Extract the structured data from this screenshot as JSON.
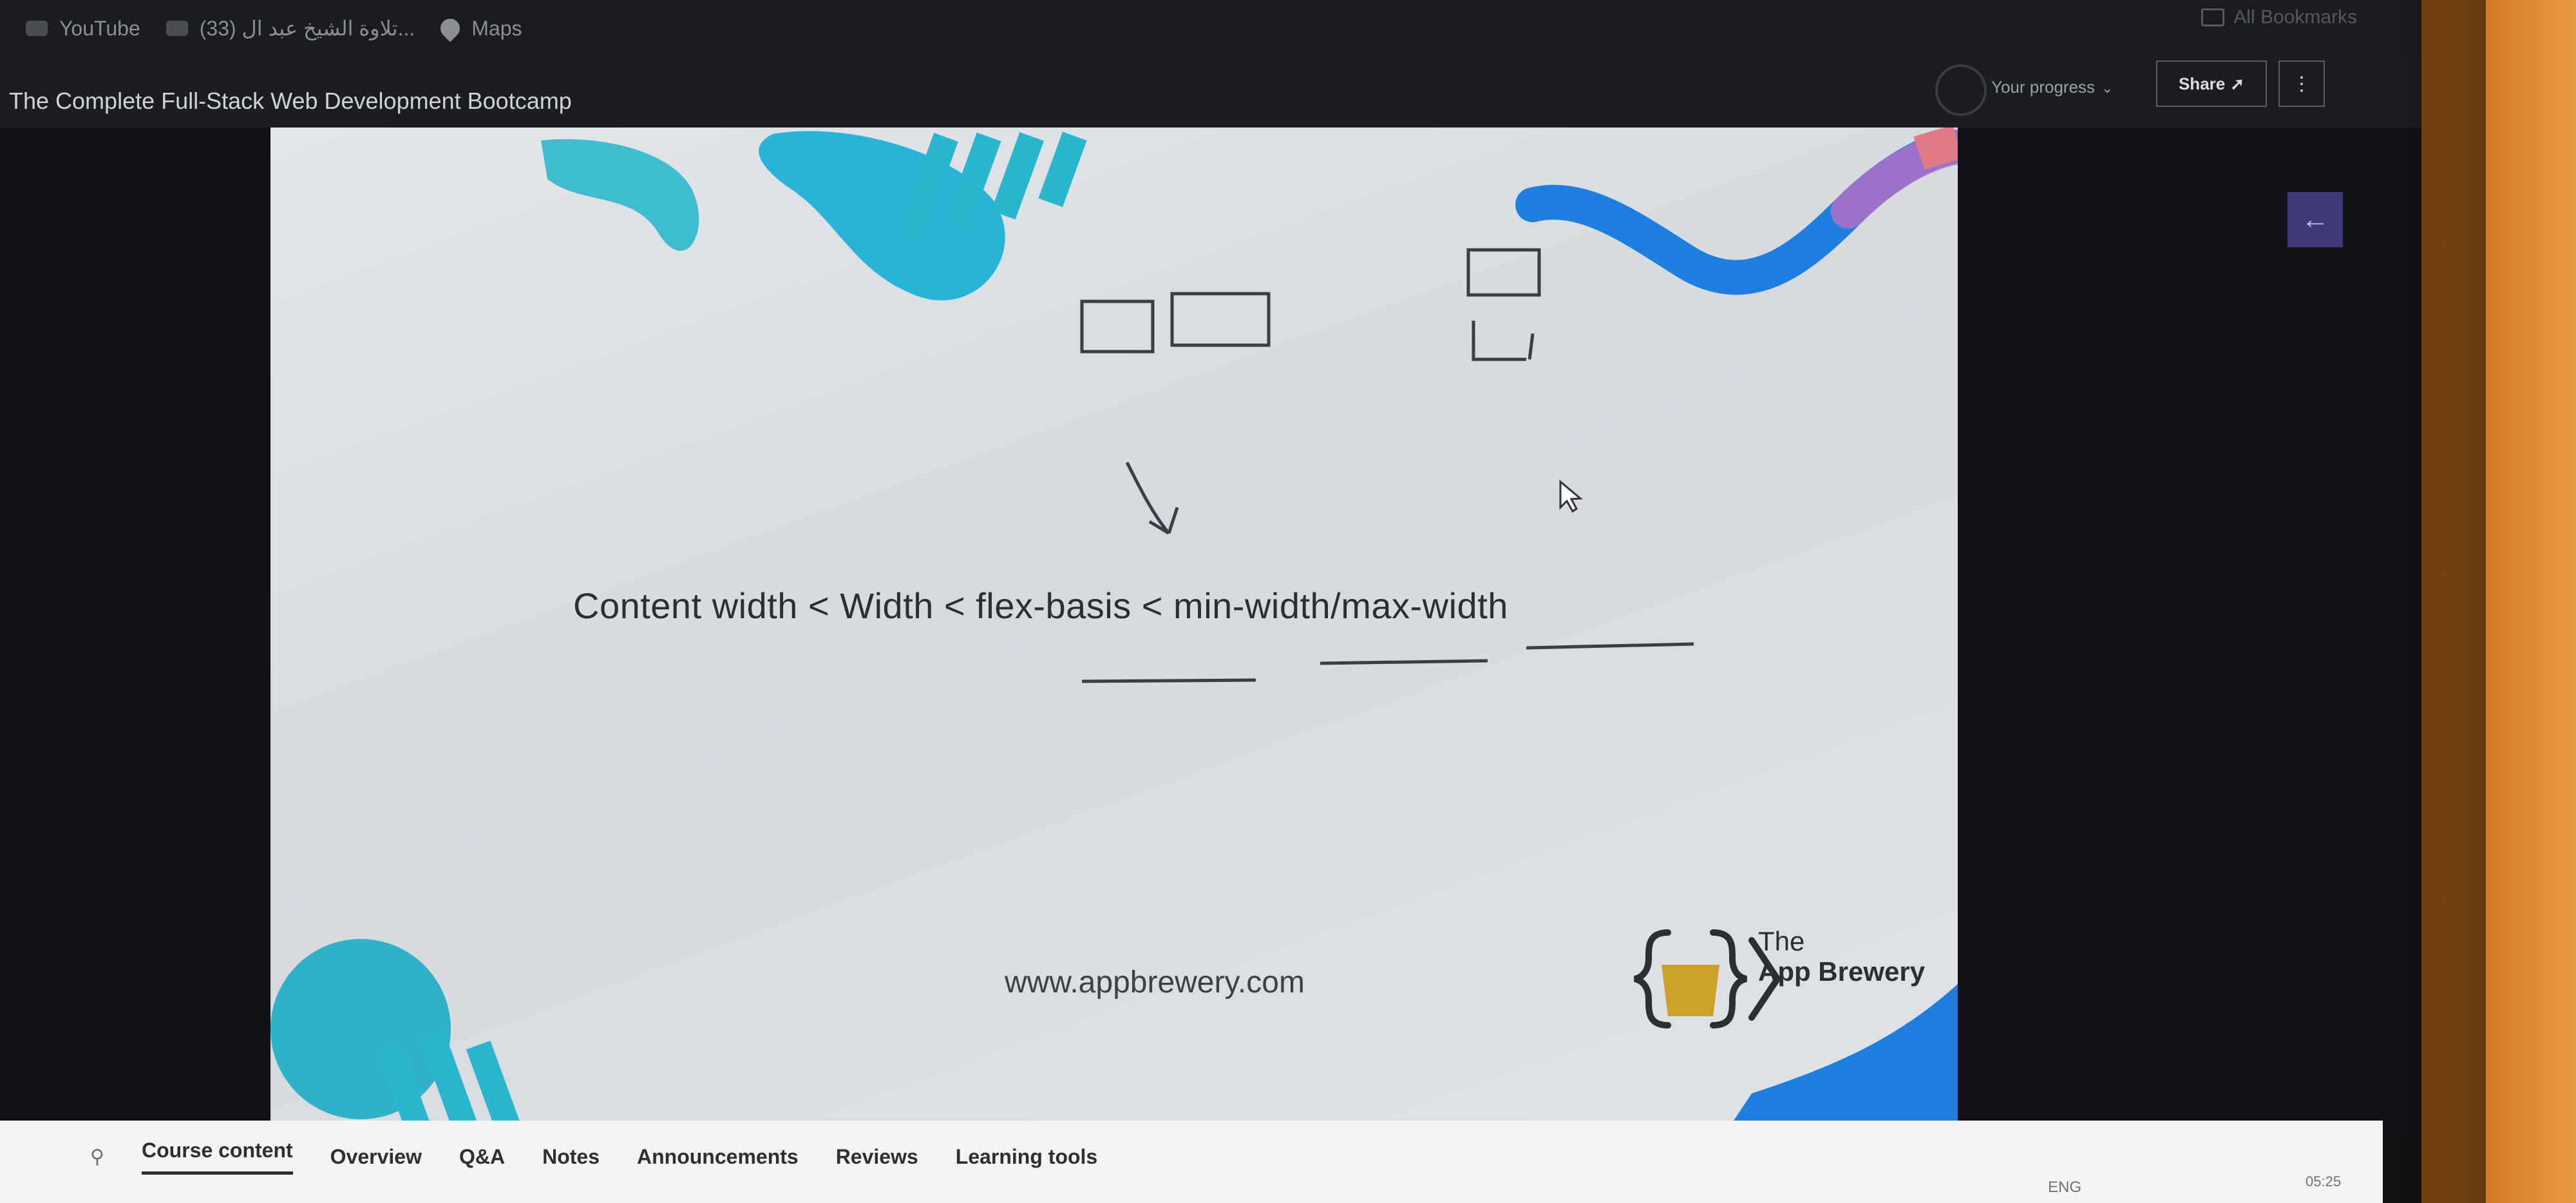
{
  "bookmarks": {
    "items": [
      {
        "label": "YouTube",
        "icon": "youtube-icon"
      },
      {
        "label": "(33) تلاوة الشيخ عبد ال...",
        "icon": "video-icon"
      },
      {
        "label": "Maps",
        "icon": "maps-pin-icon"
      }
    ],
    "all_bookmarks": "All Bookmarks"
  },
  "header": {
    "course_title": "The Complete Full-Stack Web Development Bootcamp",
    "your_progress": "Your progress",
    "share_label": "Share",
    "more_label": "⋮"
  },
  "slide": {
    "formula": "Content width < Width < flex-basis < min-width/max-width",
    "url": "www.appbrewery.com",
    "brand_line1": "The",
    "brand_line2": "App Brewery"
  },
  "tabs": {
    "items": [
      {
        "label": "Course content",
        "active": true
      },
      {
        "label": "Overview"
      },
      {
        "label": "Q&A"
      },
      {
        "label": "Notes"
      },
      {
        "label": "Announcements"
      },
      {
        "label": "Reviews"
      },
      {
        "label": "Learning tools"
      }
    ]
  },
  "taskbar": {
    "lang": "ENG",
    "time": "05:25"
  },
  "colors": {
    "accent_purple": "#3e3a7a",
    "slide_teal": "#2fb8cc",
    "slide_blue": "#1f7fe0",
    "slide_pink": "#e07a86"
  }
}
